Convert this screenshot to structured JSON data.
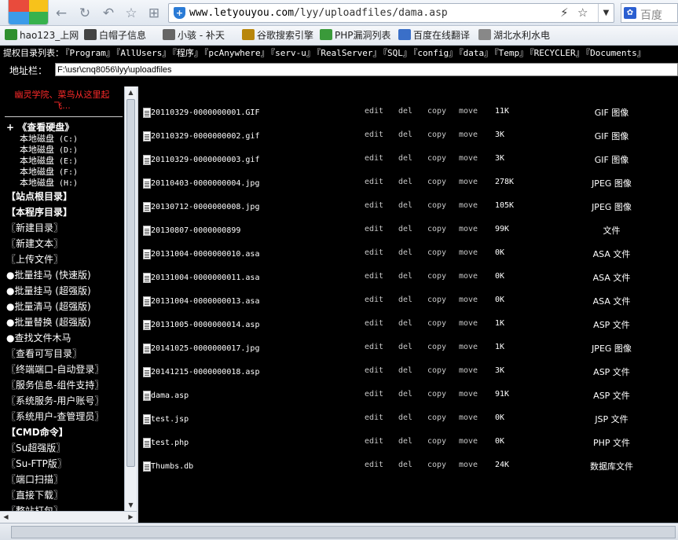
{
  "browser": {
    "url_host": "www.letyouyou.com",
    "url_path": "/lyy/uploadfiles/dama.asp",
    "search_engine": "百度"
  },
  "bookmarks": [
    {
      "label": "hao123_上网",
      "color": "#2f8f2f",
      "icon": "hao123-icon"
    },
    {
      "label": "白帽子信息",
      "color": "#444444",
      "icon": "whitehat-icon"
    },
    {
      "label": "小骇 - 补天",
      "color": "#666666",
      "icon": "star-icon"
    },
    {
      "label": "谷歌搜索引擎",
      "color": "#b8860b",
      "icon": "google-icon"
    },
    {
      "label": "PHP漏洞列表",
      "color": "#3a9a3a",
      "icon": "php-icon"
    },
    {
      "label": "百度在线翻译",
      "color": "#3a6fc8",
      "icon": "baidu-fanyi-icon"
    },
    {
      "label": "湖北水利水电",
      "color": "#888888",
      "icon": "folder-icon"
    }
  ],
  "shell": {
    "header_label": "提权目录列表：",
    "header_links": [
      "『Program』",
      "『AllUsers』",
      "『程序』",
      "『pcAnywhere』",
      "『serv-u』",
      "『RealServer』",
      "『SQL』",
      "『config』",
      "『data』",
      "『Temp』",
      "『RECYCLER』",
      "『Documents』"
    ],
    "address_label": "地址栏：",
    "address_value": "F:\\usr\\cnq8056\\lyy\\uploadfiles"
  },
  "left": {
    "ghost_text": "幽灵学院、菜鸟从这里起飞...",
    "disk_header": "+ 《查看硬盘》",
    "disks": [
      {
        "label": "本地磁盘",
        "path": "(C:)"
      },
      {
        "label": "本地磁盘",
        "path": "(D:)"
      },
      {
        "label": "本地磁盘",
        "path": "(E:)"
      },
      {
        "label": "本地磁盘",
        "path": "(F:)"
      },
      {
        "label": "本地磁盘",
        "path": "(H:)"
      }
    ],
    "items": [
      {
        "label": "【站点根目录】",
        "bold": true
      },
      {
        "label": "【本程序目录】",
        "bold": true
      },
      {
        "label": "〖新建目录〗",
        "bold": false
      },
      {
        "label": "〖新建文本〗",
        "bold": false
      },
      {
        "label": "〖上传文件〗",
        "bold": false
      },
      {
        "label": "●批量挂马 (快速版)",
        "bold": false
      },
      {
        "label": "●批量挂马 (超强版)",
        "bold": false
      },
      {
        "label": "●批量清马 (超强版)",
        "bold": false
      },
      {
        "label": "●批量替换 (超强版)",
        "bold": false
      },
      {
        "label": "●查找文件木马",
        "bold": false
      },
      {
        "label": "〖查看可写目录〗",
        "bold": false
      },
      {
        "label": "〖终端端口-自动登录〗",
        "bold": false
      },
      {
        "label": "〖服务信息-组件支持〗",
        "bold": false
      },
      {
        "label": "〖系统服务-用户账号〗",
        "bold": false
      },
      {
        "label": "〖系统用户-查管理员〗",
        "bold": false
      },
      {
        "label": "【CMD命令】",
        "bold": true
      },
      {
        "label": "〖Su超强版〗",
        "bold": false
      },
      {
        "label": "〖Su-FTP版〗",
        "bold": false
      },
      {
        "label": "〖端口扫描〗",
        "bold": false
      },
      {
        "label": "〖直接下载〗",
        "bold": false
      },
      {
        "label": "〖整站打包〗",
        "bold": false
      }
    ]
  },
  "actions": [
    "edit",
    "del",
    "copy",
    "move"
  ],
  "files": [
    {
      "name": "20110329-0000000001.GIF",
      "size": "11K",
      "type": "GIF 图像"
    },
    {
      "name": "20110329-0000000002.gif",
      "size": "3K",
      "type": "GIF 图像"
    },
    {
      "name": "20110329-0000000003.gif",
      "size": "3K",
      "type": "GIF 图像"
    },
    {
      "name": "20110403-0000000004.jpg",
      "size": "278K",
      "type": "JPEG 图像"
    },
    {
      "name": "20130712-0000000008.jpg",
      "size": "105K",
      "type": "JPEG 图像"
    },
    {
      "name": "20130807-0000000899",
      "size": "99K",
      "type": "文件"
    },
    {
      "name": "20131004-0000000010.asa",
      "size": "0K",
      "type": "ASA 文件"
    },
    {
      "name": "20131004-0000000011.asa",
      "size": "0K",
      "type": "ASA 文件"
    },
    {
      "name": "20131004-0000000013.asa",
      "size": "0K",
      "type": "ASA 文件"
    },
    {
      "name": "20131005-0000000014.asp",
      "size": "1K",
      "type": "ASP 文件"
    },
    {
      "name": "20141025-0000000017.jpg",
      "size": "1K",
      "type": "JPEG 图像"
    },
    {
      "name": "20141215-0000000018.asp",
      "size": "3K",
      "type": "ASP 文件"
    },
    {
      "name": "dama.asp",
      "size": "91K",
      "type": "ASP 文件"
    },
    {
      "name": "test.jsp",
      "size": "0K",
      "type": "JSP 文件"
    },
    {
      "name": "test.php",
      "size": "0K",
      "type": "PHP 文件"
    },
    {
      "name": "Thumbs.db",
      "size": "24K",
      "type": "数据库文件"
    }
  ]
}
